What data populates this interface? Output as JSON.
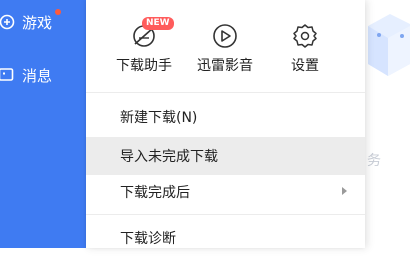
{
  "sidebar": {
    "items": [
      {
        "label": "游戏",
        "icon": "gamepad-icon",
        "has_dot": true
      },
      {
        "label": "消息",
        "icon": "message-icon",
        "has_dot": false
      }
    ],
    "background_color": "#3f7bf2"
  },
  "menu": {
    "quick_actions": [
      {
        "label": "下载助手",
        "icon": "download-assistant-icon",
        "badge": "NEW"
      },
      {
        "label": "迅雷影音",
        "icon": "media-player-icon"
      },
      {
        "label": "设置",
        "icon": "gear-icon"
      }
    ],
    "items": [
      {
        "label": "新建下载(N)"
      },
      {
        "label": "导入未完成下载",
        "highlighted": true
      },
      {
        "label": "下载完成后",
        "has_submenu": true
      },
      {
        "label": "下载诊断"
      }
    ]
  },
  "background": {
    "partial_text": "务"
  }
}
